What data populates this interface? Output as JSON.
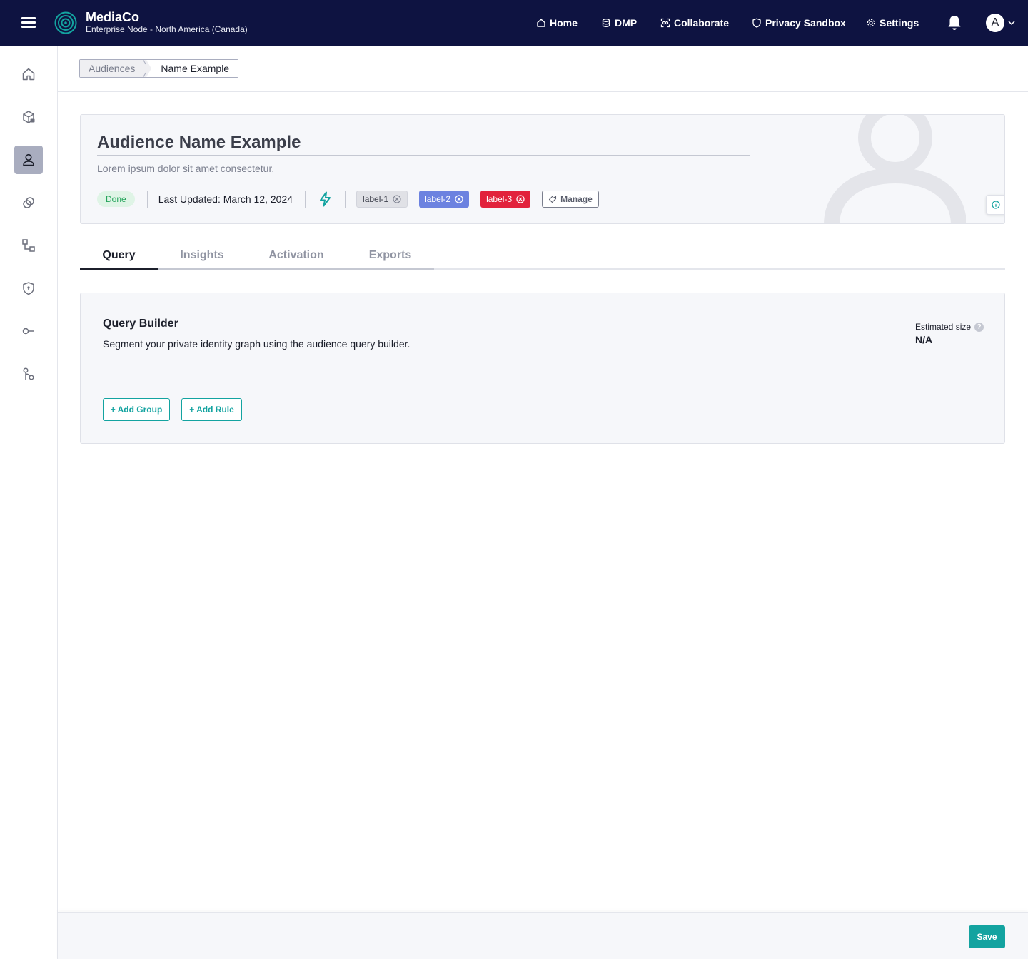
{
  "app": {
    "brand_name": "MediaCo",
    "node": "Enterprise Node - North America (Canada)"
  },
  "topnav": {
    "items": [
      {
        "label": "Home",
        "icon": "home-icon"
      },
      {
        "label": "DMP",
        "icon": "database-icon"
      },
      {
        "label": "Collaborate",
        "icon": "collaborate-icon"
      },
      {
        "label": "Privacy Sandbox",
        "icon": "shield-icon"
      },
      {
        "label": "Settings",
        "icon": "gear-icon"
      }
    ],
    "avatar_initial": "A"
  },
  "sidebar": {
    "items": [
      {
        "name": "home",
        "icon": "home-icon",
        "active": false
      },
      {
        "name": "data",
        "icon": "cube-lock-icon",
        "active": false
      },
      {
        "name": "audiences",
        "icon": "user-icon",
        "active": true
      },
      {
        "name": "connections",
        "icon": "link-icon",
        "active": false
      },
      {
        "name": "workflows",
        "icon": "flow-icon",
        "active": false
      },
      {
        "name": "privacy",
        "icon": "shield-icon",
        "active": false
      },
      {
        "name": "keys",
        "icon": "key-icon",
        "active": false
      },
      {
        "name": "integrations",
        "icon": "branch-icon",
        "active": false
      }
    ]
  },
  "breadcrumb": {
    "parent": "Audiences",
    "current": "Name Example"
  },
  "audience": {
    "title": "Audience Name Example",
    "description": "Lorem ipsum dolor sit amet consectetur.",
    "status": "Done",
    "last_updated": "Last Updated: March 12, 2024",
    "labels": [
      "label-1",
      "label-2",
      "label-3"
    ],
    "manage_label": "Manage"
  },
  "tabs": [
    "Query",
    "Insights",
    "Activation",
    "Exports"
  ],
  "active_tab": "Query",
  "query_builder": {
    "title": "Query Builder",
    "description": "Segment your private identity graph using the audience query builder.",
    "estimated_size_label": "Estimated size",
    "estimated_size_value": "N/A",
    "add_group_label": "+ Add Group",
    "add_rule_label": "+ Add Rule"
  },
  "footer": {
    "save_label": "Save"
  },
  "colors": {
    "topbar": "#0e1341",
    "accent": "#13a3a0",
    "label2": "#6c82e0",
    "label3": "#e2223c",
    "done_bg": "#dff4e6",
    "done_text": "#24a45a"
  }
}
